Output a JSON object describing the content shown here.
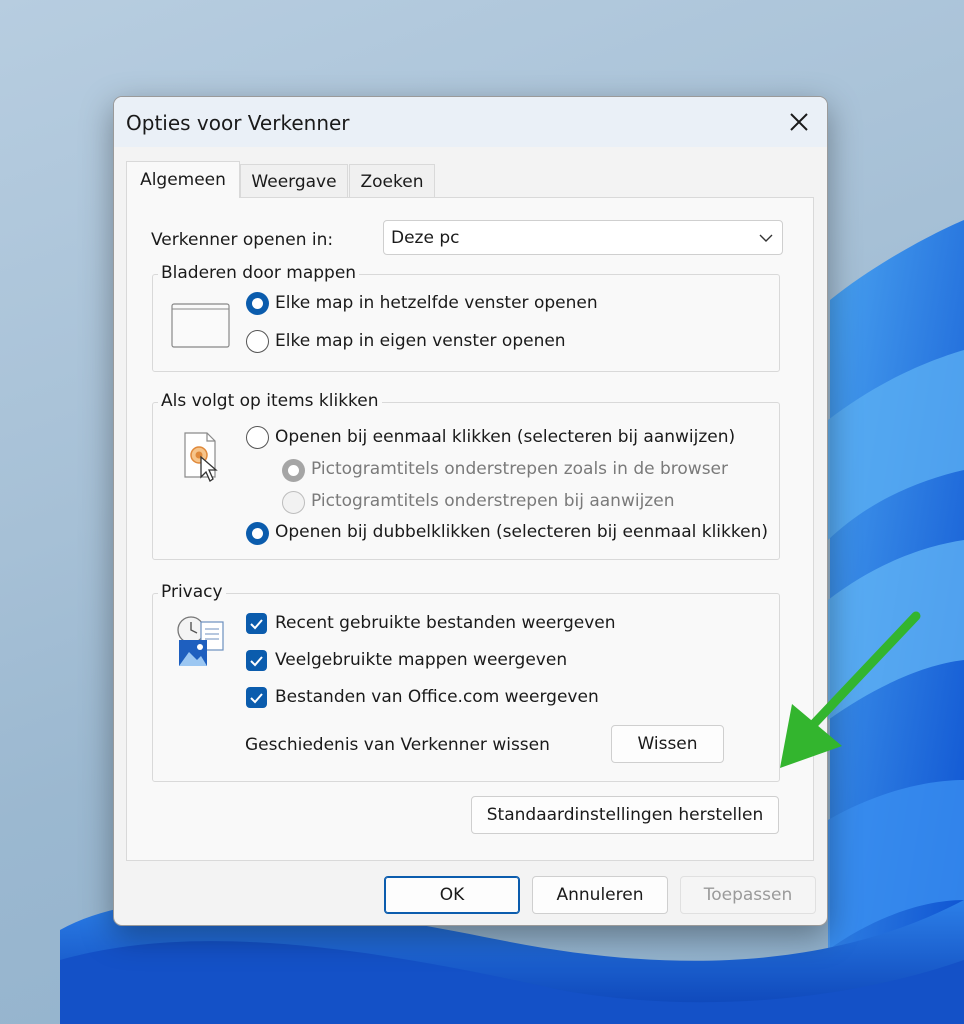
{
  "dialog": {
    "title": "Opties voor Verkenner",
    "tabs": [
      {
        "label": "Algemeen",
        "active": true
      },
      {
        "label": "Weergave",
        "active": false
      },
      {
        "label": "Zoeken",
        "active": false
      }
    ],
    "open_in": {
      "label": "Verkenner openen in:",
      "selected": "Deze pc"
    },
    "browse_folders": {
      "title": "Bladeren door mappen",
      "options": [
        {
          "label": "Elke map in hetzelfde venster openen",
          "checked": true
        },
        {
          "label": "Elke map in eigen venster openen",
          "checked": false
        }
      ]
    },
    "click_items": {
      "title": "Als volgt op items klikken",
      "single_click": {
        "label": "Openen bij eenmaal klikken (selecteren bij aanwijzen)",
        "checked": false
      },
      "sub_options": [
        {
          "label": "Pictogramtitels onderstrepen zoals in de browser",
          "checked": true,
          "disabled": true
        },
        {
          "label": "Pictogramtitels onderstrepen bij aanwijzen",
          "checked": false,
          "disabled": true
        }
      ],
      "double_click": {
        "label": "Openen bij dubbelklikken (selecteren bij eenmaal klikken)",
        "checked": true
      }
    },
    "privacy": {
      "title": "Privacy",
      "checkboxes": [
        {
          "label": "Recent gebruikte bestanden weergeven",
          "checked": true
        },
        {
          "label": "Veelgebruikte mappen weergeven",
          "checked": true
        },
        {
          "label": "Bestanden van Office.com weergeven",
          "checked": true
        }
      ],
      "clear_history_label": "Geschiedenis van Verkenner wissen",
      "clear_button": "Wissen"
    },
    "restore_defaults_button": "Standaardinstellingen herstellen",
    "buttons": {
      "ok": "OK",
      "cancel": "Annuleren",
      "apply": "Toepassen",
      "apply_disabled": true
    }
  },
  "colors": {
    "accent": "#0b5cad",
    "arrow": "#33b52e"
  }
}
